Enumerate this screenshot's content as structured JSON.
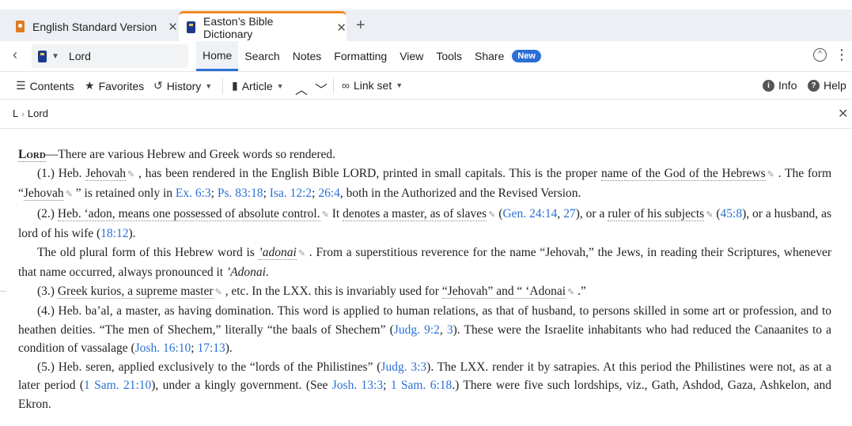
{
  "tabs": [
    {
      "label": "English Standard Version"
    },
    {
      "label": "Easton’s Bible Dictionary"
    }
  ],
  "toolbar": {
    "resource_title": "Lord",
    "menu": [
      "Home",
      "Search",
      "Notes",
      "Formatting",
      "View",
      "Tools",
      "Share"
    ],
    "new_badge": "New"
  },
  "toolbar2": {
    "contents": "Contents",
    "favorites": "Favorites",
    "history": "History",
    "article": "Article",
    "link_set": "Link set",
    "info": "Info",
    "help": "Help"
  },
  "breadcrumb": {
    "root": "L",
    "current": "Lord"
  },
  "article": {
    "headword": "Lord",
    "intro": "—There are various Hebrew and Greek words so rendered.",
    "p1": {
      "a": "(1.) Heb. ",
      "b": "Jehovah",
      "c": " , has been rendered in the English Bible LORD, printed in small capitals. This is the proper ",
      "d": "name of the God of the Hebrews",
      "e": " . The form “",
      "f": "Jehovah",
      "g": " ” is retained only in ",
      "r1": "Ex. 6:3",
      "s1": "; ",
      "r2": "Ps. 83:18",
      "s2": "; ",
      "r3": "Isa. 12:2",
      "s3": "; ",
      "r4": "26:4",
      "h": ", both in the Authorized and the Revised Version."
    },
    "p2": {
      "a": "(2.) ",
      "b": "Heb. ‘adon, means one possessed of absolute control.",
      "c": " It ",
      "d": "denotes a master, as of slaves",
      "e": " (",
      "r1": "Gen. 24:14",
      "s1": ", ",
      "r2": "27",
      "f": "), or a ",
      "g": "ruler of his subjects",
      "h": " (",
      "r3": "45:8",
      "i": "), or a husband, as lord of his wife (",
      "r4": "18:12",
      "j": ")."
    },
    "p3": {
      "a": "The old plural form of this Hebrew word is ",
      "b": "’adonai",
      "c": " . From a superstitious reverence for the name “Jehovah,” the Jews, in reading their Scriptures, whenever that name occurred, always pronounced it ",
      "d": "’Adonai",
      "e": "."
    },
    "p4": {
      "a": "(3.) ",
      "b": "Greek kurios, a supreme master",
      "c": " , etc. In the LXX. this is invariably used for ",
      "d": "“Jehovah” and “ ‘Adonai",
      "e": " .”"
    },
    "p5": {
      "a": "(4.) Heb. ba’al, a master, as having domination. This word is applied to human relations, as that of husband, to persons skilled in some art or profession, and to heathen deities. “The men of Shechem,” literally “the baals of Shechem” (",
      "r1": "Judg. 9:2",
      "s1": ", ",
      "r2": "3",
      "b": "). These were the Israelite inhabitants who had reduced the Canaanites to a condition of vassalage (",
      "r3": "Josh. 16:10",
      "s2": "; ",
      "r4": "17:13",
      "c": ")."
    },
    "p6": {
      "a": "(5.) Heb. seren, applied exclusively to the “lords of the Philistines” (",
      "r1": "Judg. 3:3",
      "b": "). The LXX. render it by satrapies. At this period the Philistines were not, as at a later period (",
      "r2": "1 Sam. 21:10",
      "c": "), under a kingly government. (See ",
      "r3": "Josh. 13:3",
      "s1": "; ",
      "r4": "1 Sam. 6:18",
      "d": ".) There were five such lordships, viz., Gath, Ashdod, Gaza, Ashkelon, and Ekron."
    }
  },
  "colors": {
    "accent": "#2b6fd6",
    "tab_highlight": "#f08a24",
    "link": "#2b6fd6"
  }
}
